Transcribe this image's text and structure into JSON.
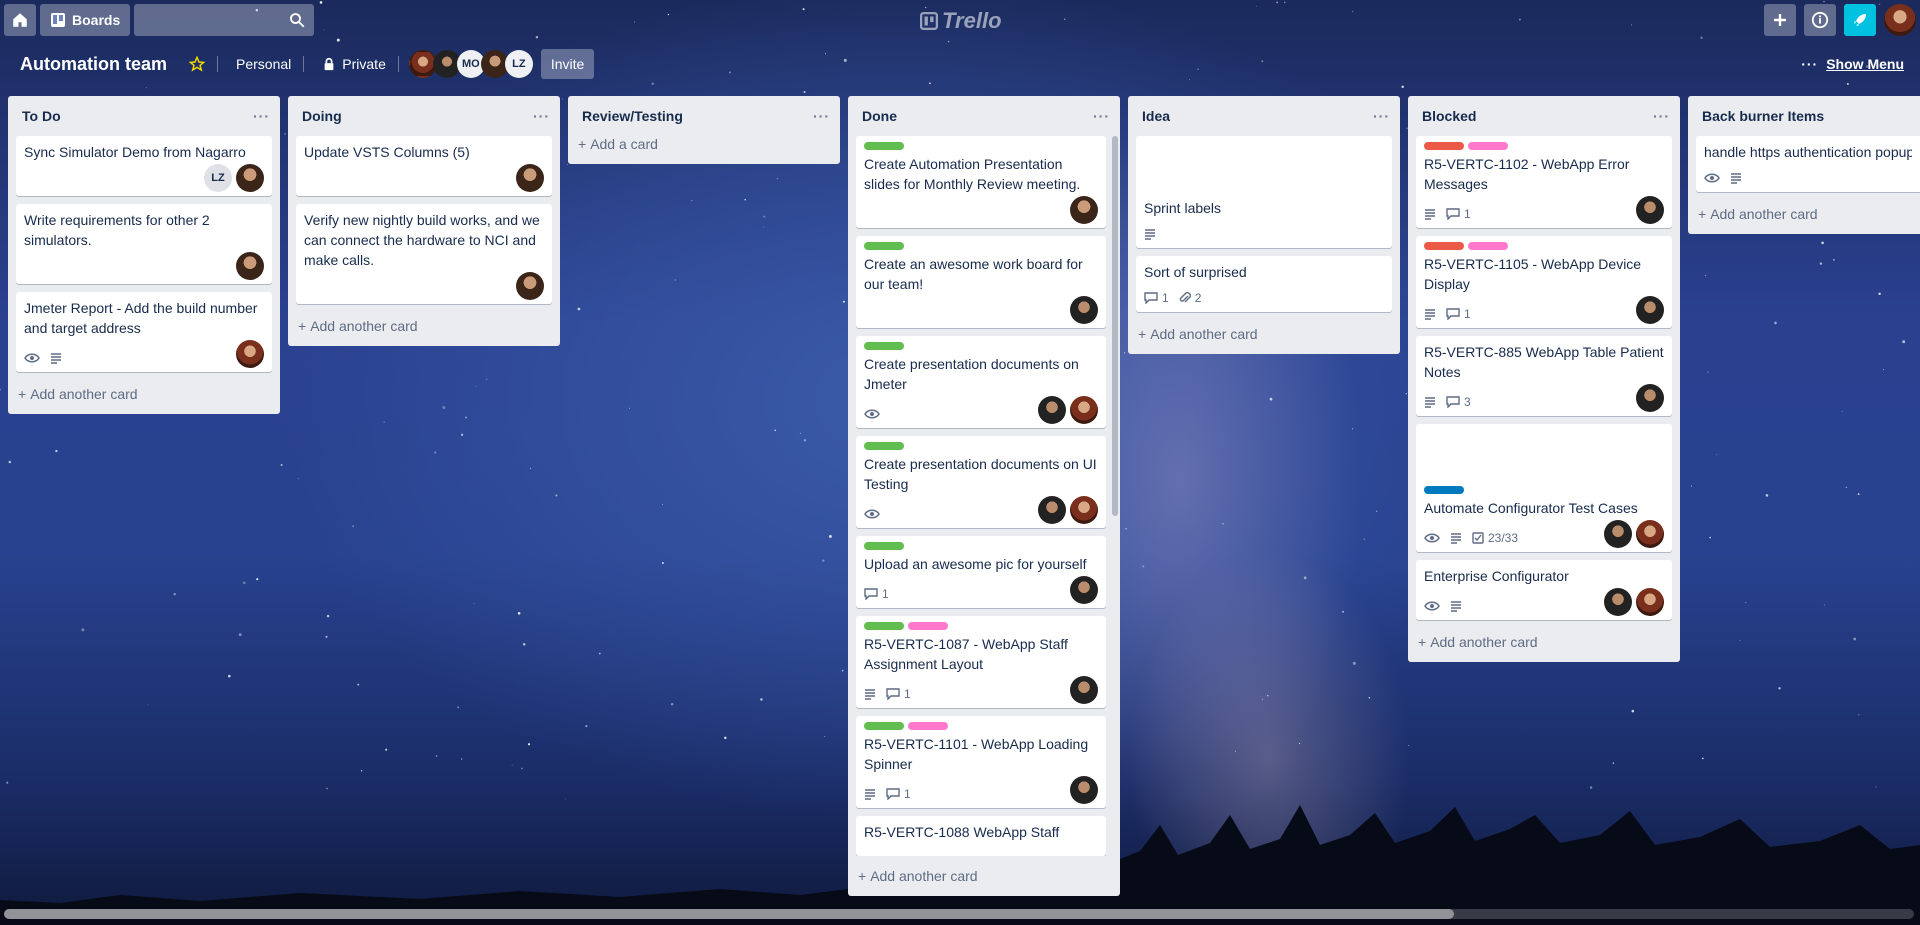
{
  "header": {
    "boards_label": "Boards",
    "search_placeholder": "",
    "logo": "Trello"
  },
  "board": {
    "title": "Automation team",
    "visibility_team": "Personal",
    "visibility_privacy": "Private",
    "members": [
      "",
      "",
      "MO",
      "",
      "LZ"
    ],
    "invite_label": "Invite",
    "show_menu_label": "Show Menu"
  },
  "colors": {
    "green": "#61bd4f",
    "pink": "#ff78cb",
    "red": "#eb5a46",
    "blue": "#0079bf",
    "accent": "#00c2e0"
  },
  "lists": [
    {
      "name": "To Do",
      "cards": [
        {
          "title": "Sync Simulator Demo from Nagarro",
          "members": [
            "LZ",
            "avatar"
          ]
        },
        {
          "title": "Write requirements for other 2 simulators.",
          "members": [
            "avatar"
          ]
        },
        {
          "title": "Jmeter Report - Add the build number and target address",
          "badges": [
            "eye-icon",
            "description-icon"
          ],
          "members": [
            "avatar"
          ]
        }
      ],
      "add_label": "Add another card"
    },
    {
      "name": "Doing",
      "cards": [
        {
          "title": "Update VSTS Columns (5)",
          "members": [
            "avatar"
          ]
        },
        {
          "title": "Verify new nightly build works, and we can connect the hardware to NCI and make calls.",
          "members": [
            "avatar"
          ]
        }
      ],
      "add_label": "Add another card"
    },
    {
      "name": "Review/Testing",
      "cards": [],
      "add_label": "Add a card"
    },
    {
      "name": "Done",
      "cards": [
        {
          "labels": [
            "green"
          ],
          "title": "Create Automation Presentation slides for Monthly Review meeting."
        },
        {
          "labels": [
            "green"
          ],
          "title": "Create an awesome work board for our team!"
        },
        {
          "labels": [
            "green"
          ],
          "title": "Create presentation documents on Jmeter"
        },
        {
          "labels": [
            "green"
          ],
          "title": "Create presentation documents on UI Testing"
        },
        {
          "labels": [
            "green"
          ],
          "title": "Upload an awesome pic for yourself",
          "comments": "1"
        },
        {
          "labels": [
            "green",
            "pink"
          ],
          "title": "R5-VERTC-1087 - WebApp Staff Assignment Layout",
          "comments": "1"
        },
        {
          "labels": [
            "green",
            "pink"
          ],
          "title": "R5-VERTC-1101 - WebApp Loading Spinner",
          "comments": "1"
        },
        {
          "title": "R5-VERTC-1088 WebApp Staff"
        }
      ],
      "add_label": "Add another card"
    },
    {
      "name": "Idea",
      "cards": [
        {
          "title": "Sprint labels"
        },
        {
          "title": "Sort of surprised",
          "comments": "1",
          "attachments": "2"
        }
      ],
      "add_label": "Add another card"
    },
    {
      "name": "Blocked",
      "cards": [
        {
          "labels": [
            "red",
            "pink"
          ],
          "title": "R5-VERTC-1102 - WebApp Error Messages",
          "comments": "1"
        },
        {
          "labels": [
            "red",
            "pink"
          ],
          "title": "R5-VERTC-1105 - WebApp Device Display",
          "comments": "1"
        },
        {
          "title": "R5-VERTC-885 WebApp Table Patient Notes",
          "comments": "3"
        },
        {
          "labels": [
            "blue"
          ],
          "title": "Automate Configurator Test Cases",
          "checklist": "23/33"
        },
        {
          "title": "Enterprise Configurator"
        }
      ],
      "add_label": "Add another card"
    },
    {
      "name": "Back burner Items",
      "cards": [
        {
          "title": "handle https authentication popup"
        }
      ],
      "add_label": "Add another card"
    }
  ]
}
